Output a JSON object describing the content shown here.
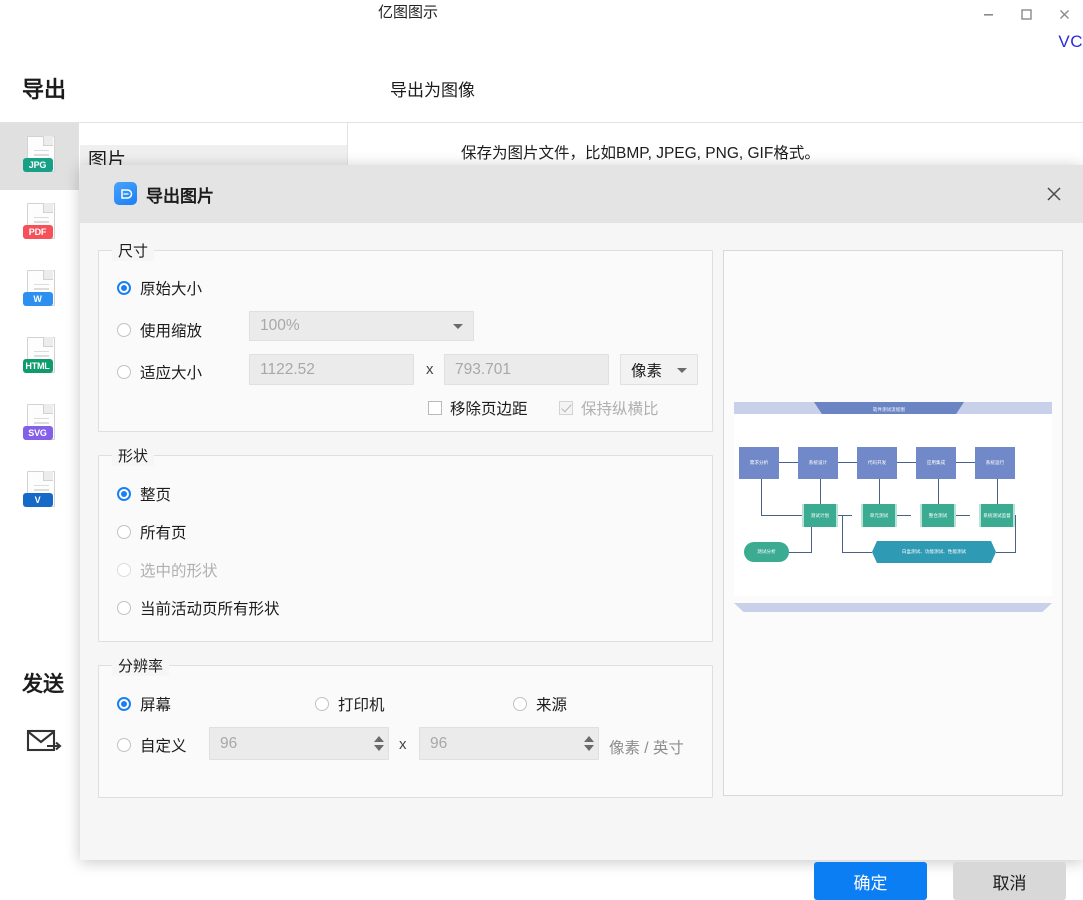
{
  "window": {
    "app_title": "亿图图示",
    "minimize": "minimize-icon",
    "maximize": "maximize-icon",
    "close": "close-icon",
    "vc_label": "VC"
  },
  "backstage": {
    "export_title": "导出",
    "page_title": "导出为图像",
    "section_label": "图片",
    "description": "保存为图片文件，比如BMP, JPEG, PNG, GIF格式。",
    "send_label": "发送",
    "formats": [
      {
        "name": "jpg",
        "badge": "JPG",
        "color": "#17a086"
      },
      {
        "name": "pdf",
        "badge": "PDF",
        "color": "#f5515a"
      },
      {
        "name": "word",
        "badge": "W",
        "color": "#2b90f0"
      },
      {
        "name": "html",
        "badge": "HTML",
        "color": "#109b6b"
      },
      {
        "name": "svg",
        "badge": "SVG",
        "color": "#8460e8"
      },
      {
        "name": "visio",
        "badge": "V",
        "color": "#1569c7"
      }
    ]
  },
  "dialog": {
    "title": "导出图片",
    "close_label": "×",
    "size": {
      "legend": "尺寸",
      "original_label": "原始大小",
      "scale_label": "使用缩放",
      "scale_value": "100%",
      "fit_label": "适应大小",
      "width_value": "1122.52",
      "height_value": "793.701",
      "x_symbol": "x",
      "unit_value": "像素",
      "remove_margin_label": "移除页边距",
      "keep_ratio_label": "保持纵横比"
    },
    "shape": {
      "legend": "形状",
      "options": [
        "整页",
        "所有页",
        "选中的形状",
        "当前活动页所有形状"
      ]
    },
    "resolution": {
      "legend": "分辨率",
      "screen_label": "屏幕",
      "printer_label": "打印机",
      "source_label": "来源",
      "custom_label": "自定义",
      "dpi_x": "96",
      "dpi_y": "96",
      "x_symbol": "x",
      "unit": "像素 / 英寸"
    },
    "buttons": {
      "ok": "确定",
      "cancel": "取消"
    }
  },
  "preview": {
    "banner_title": "软件测试流程图",
    "row_top": [
      "需求分析",
      "系统设计",
      "代码开发",
      "应用集成",
      "系统运行"
    ],
    "row_mid": [
      "测试计划",
      "单元测试",
      "整合测试",
      "系统测试监督"
    ],
    "pill": "测试分析",
    "hexagon": "白盒测试、功能测试、性能测试"
  }
}
